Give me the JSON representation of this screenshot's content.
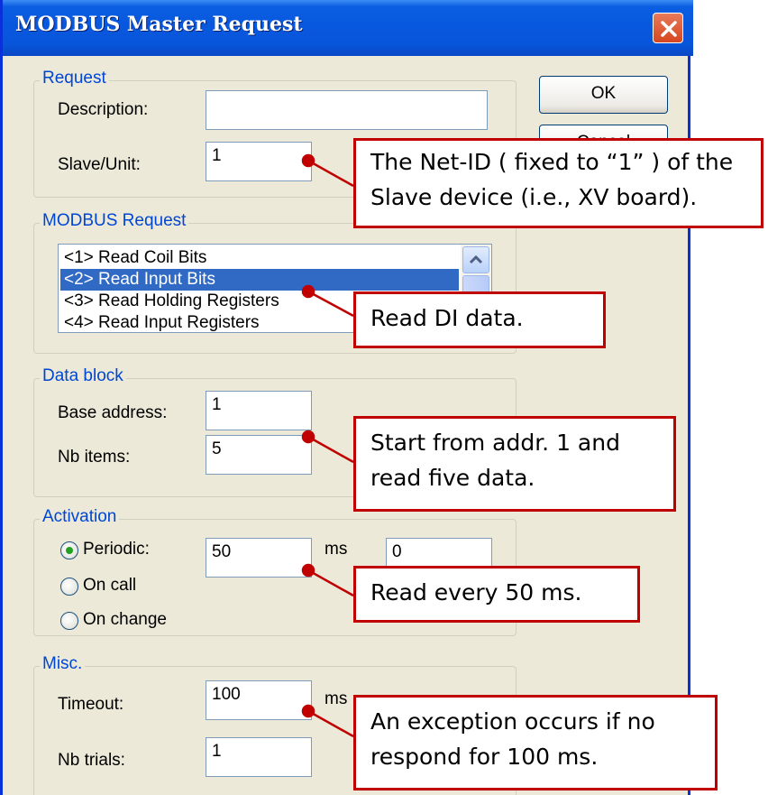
{
  "window": {
    "title": "MODBUS Master Request",
    "close_icon": "close-icon"
  },
  "buttons": {
    "ok": "OK",
    "cancel": "Cancel"
  },
  "request": {
    "group_label": "Request",
    "description_label": "Description:",
    "description_value": "",
    "slave_label": "Slave/Unit:",
    "slave_value": "1"
  },
  "modbus_request": {
    "group_label": "MODBUS Request",
    "items": [
      "<1> Read Coil Bits",
      "<2> Read Input Bits",
      "<3> Read Holding Registers",
      "<4> Read Input Registers"
    ],
    "selected_index": 1
  },
  "data_block": {
    "group_label": "Data block",
    "base_address_label": "Base address:",
    "base_address_value": "1",
    "nb_items_label": "Nb items:",
    "nb_items_value": "5"
  },
  "activation": {
    "group_label": "Activation",
    "periodic_label": "Periodic:",
    "periodic_value": "50",
    "unit": "ms",
    "extra_value": "0",
    "on_call_label": "On call",
    "on_change_label": "On change",
    "selected": "periodic"
  },
  "misc": {
    "group_label": "Misc.",
    "timeout_label": "Timeout:",
    "timeout_value": "100",
    "unit": "ms",
    "nb_trials_label": "Nb trials:",
    "nb_trials_value": "1"
  },
  "callouts": {
    "slave": {
      "line1": "The Net-ID ( fixed to “1” ) of the",
      "line2": "Slave device (i.e., XV board)."
    },
    "read_di": {
      "line1": "Read DI data."
    },
    "data_block": {
      "line1": "Start from addr. 1 and",
      "line2": "read five data."
    },
    "period": {
      "line1": "Read every 50 ms."
    },
    "timeout": {
      "line1": "An exception occurs if no",
      "line2": "respond for 100 ms."
    }
  },
  "colors": {
    "callout_border": "#c00000",
    "title_bar": "#0a5ee0",
    "selection": "#316ac5",
    "group_label": "#0046d5"
  }
}
